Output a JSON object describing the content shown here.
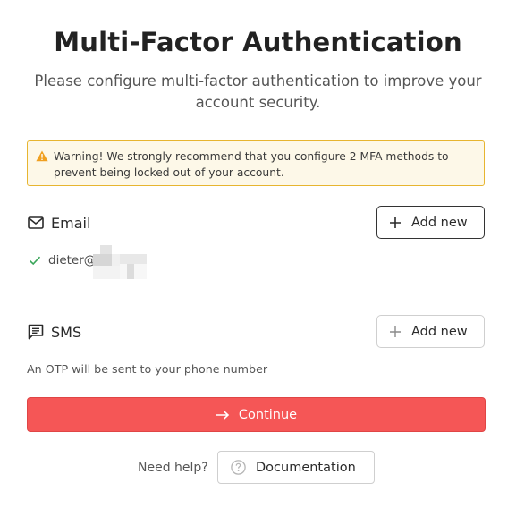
{
  "header": {
    "title": "Multi-Factor Authentication",
    "subtitle": "Please configure multi-factor authentication to improve your account security."
  },
  "warning": {
    "icon": "warning-triangle-icon",
    "text": "Warning! We strongly recommend that you configure 2 MFA methods to prevent being locked out of your account.",
    "accent": "#e7b530"
  },
  "email_section": {
    "icon": "envelope-icon",
    "label": "Email",
    "add_label": "Add new",
    "configured_address": "dieter@",
    "status_icon": "check-icon"
  },
  "sms_section": {
    "icon": "message-icon",
    "label": "SMS",
    "add_label": "Add new",
    "note": "An OTP will be sent to your phone number"
  },
  "continue_button": {
    "label": "Continue",
    "icon": "arrow-right-icon",
    "color": "#f55656"
  },
  "help": {
    "text": "Need help?",
    "doc_label": "Documentation",
    "doc_icon": "question-circle-icon"
  }
}
